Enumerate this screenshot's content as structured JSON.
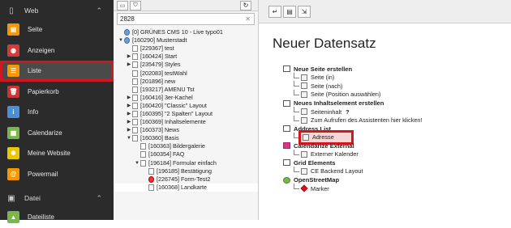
{
  "module_menu": {
    "groups": [
      {
        "label": "Web",
        "icon": "document-icon"
      },
      {
        "label": "Datei",
        "icon": "image-icon"
      }
    ],
    "web_items": [
      {
        "label": "Seite",
        "icon": "page-module-icon",
        "color": "#f49700",
        "glyph": "▤"
      },
      {
        "label": "Anzeigen",
        "icon": "view-module-icon",
        "color": "#d63b3b",
        "glyph": "◉"
      },
      {
        "label": "Liste",
        "icon": "list-module-icon",
        "color": "#f49700",
        "glyph": "☰"
      },
      {
        "label": "Papierkorb",
        "icon": "recycler-module-icon",
        "color": "#c33",
        "glyph": "🗑"
      },
      {
        "label": "Info",
        "icon": "info-module-icon",
        "color": "#4a90d9",
        "glyph": "i"
      },
      {
        "label": "Calendarize",
        "icon": "calendar-module-icon",
        "color": "#7ab648",
        "glyph": "▦"
      },
      {
        "label": "Meine Website",
        "icon": "sun-icon",
        "color": "#e8c800",
        "glyph": "✹"
      },
      {
        "label": "Powermail",
        "icon": "powermail-icon",
        "color": "#f49700",
        "glyph": "@"
      }
    ],
    "datei_items": [
      {
        "label": "Dateiliste",
        "icon": "filelist-module-icon",
        "color": "#7ab648",
        "glyph": "▲"
      }
    ]
  },
  "tree": {
    "search_value": "2828",
    "nodes": [
      {
        "label": "[0] GRÜNES CMS 10 - Live typo01",
        "depth": 0,
        "toggle": "",
        "icon": "globe"
      },
      {
        "label": "[160290] Musterstadt",
        "depth": 0,
        "toggle": "▼",
        "icon": "globe"
      },
      {
        "label": "[229367] test",
        "depth": 1,
        "toggle": "",
        "icon": "page"
      },
      {
        "label": "[160424] Start",
        "depth": 1,
        "toggle": "▶",
        "icon": "page"
      },
      {
        "label": "[235479] Styles",
        "depth": 1,
        "toggle": "▶",
        "icon": "page"
      },
      {
        "label": "[202083] testWahl",
        "depth": 1,
        "toggle": "",
        "icon": "page"
      },
      {
        "label": "[201896] new",
        "depth": 1,
        "toggle": "",
        "icon": "page"
      },
      {
        "label": "[193217] AMENU Tst",
        "depth": 1,
        "toggle": "",
        "icon": "page"
      },
      {
        "label": "[160416] 3er-Kachel",
        "depth": 1,
        "toggle": "▶",
        "icon": "page"
      },
      {
        "label": "[160420] \"Classic\" Layout",
        "depth": 1,
        "toggle": "▶",
        "icon": "page"
      },
      {
        "label": "[160395] \"2 Spalten\" Layout",
        "depth": 1,
        "toggle": "▶",
        "icon": "page"
      },
      {
        "label": "[160369] Inhaltselemente",
        "depth": 1,
        "toggle": "▶",
        "icon": "page"
      },
      {
        "label": "[160373] News",
        "depth": 1,
        "toggle": "▶",
        "icon": "page"
      },
      {
        "label": "[160360] Basis",
        "depth": 1,
        "toggle": "▼",
        "icon": "page"
      },
      {
        "label": "[160363] Bildergalerie",
        "depth": 2,
        "toggle": "",
        "icon": "page"
      },
      {
        "label": "[160354] FAQ",
        "depth": 2,
        "toggle": "",
        "icon": "page"
      },
      {
        "label": "[196184] Formular einfach",
        "depth": 2,
        "toggle": "▼",
        "icon": "page"
      },
      {
        "label": "[196185] Bestätigung",
        "depth": 3,
        "toggle": "",
        "icon": "page"
      },
      {
        "label": "[226745] Form-Test2",
        "depth": 3,
        "toggle": "",
        "icon": "red"
      },
      {
        "label": "[160368] Landkarte",
        "depth": 3,
        "toggle": "",
        "icon": "page",
        "selected": true
      }
    ]
  },
  "main": {
    "title": "Neuer Datensatz",
    "sections": [
      {
        "label": "Neue Seite erstellen",
        "icon": "new-page-icon",
        "items": [
          {
            "label": "Seite (in)"
          },
          {
            "label": "Seite (nach)"
          },
          {
            "label": "Seite (Position auswählen)"
          }
        ]
      },
      {
        "label": "Neues Inhaltselement erstellen",
        "icon": "content-element-icon",
        "items": [
          {
            "label": "Seiteninhalt",
            "extra": "?"
          },
          {
            "label": "Zum Aufrufen des Assistenten hier klicken!"
          }
        ]
      },
      {
        "label": "Address List",
        "icon": "address-list-icon",
        "items": [
          {
            "label": "Adresse",
            "highlight": true
          }
        ]
      },
      {
        "label": "Calendarize External",
        "icon": "calendarize-icon",
        "items": [
          {
            "label": "Externer Kalender"
          }
        ]
      },
      {
        "label": "Grid Elements",
        "icon": "grid-elements-icon",
        "items": [
          {
            "label": "CE Backend Layout"
          }
        ]
      },
      {
        "label": "OpenStreetMap",
        "icon": "openstreetmap-icon",
        "items": [
          {
            "label": "Marker"
          }
        ]
      }
    ]
  },
  "colors": {
    "highlight_border": "#d0161e",
    "module_bg": "#2b2b2b"
  }
}
